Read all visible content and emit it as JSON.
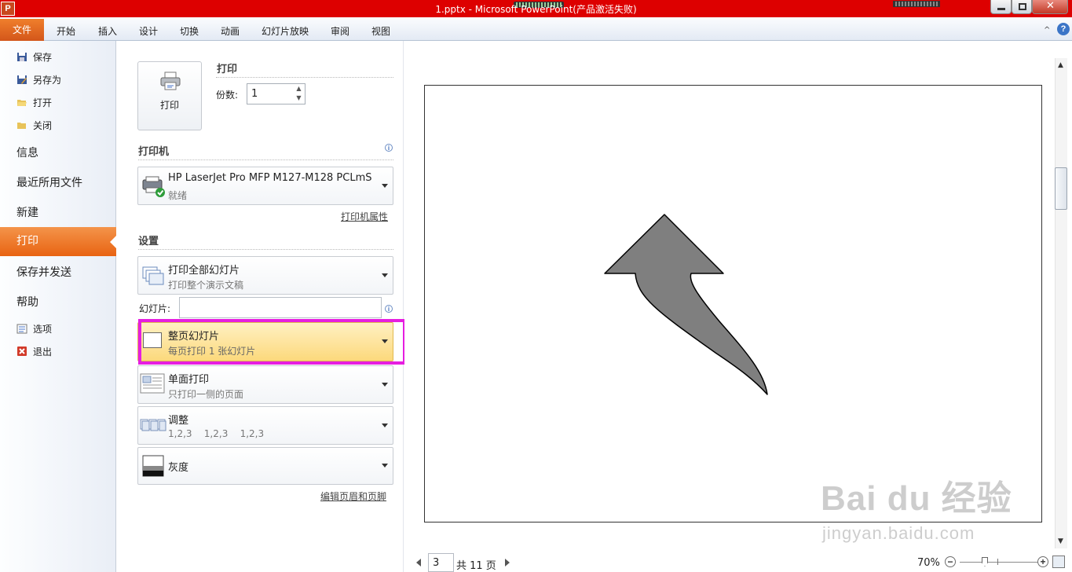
{
  "window": {
    "title": "1.pptx - Microsoft PowerPoint(产品激活失败)",
    "app_icon": "P"
  },
  "ribbon": {
    "file_tab": "文件",
    "tabs": [
      "开始",
      "插入",
      "设计",
      "切换",
      "动画",
      "幻灯片放映",
      "审阅",
      "视图"
    ],
    "help_icon": "?"
  },
  "nav": {
    "save": "保存",
    "save_as": "另存为",
    "open": "打开",
    "close": "关闭",
    "info": "信息",
    "recent": "最近所用文件",
    "new": "新建",
    "print": "打印",
    "save_send": "保存并发送",
    "help": "帮助",
    "options": "选项",
    "exit": "退出"
  },
  "print": {
    "button_label": "打印",
    "section_title": "打印",
    "copies_label": "份数:",
    "copies_value": "1"
  },
  "printer": {
    "section_title": "打印机",
    "name": "HP LaserJet Pro MFP M127-M128 PCLmS",
    "status": "就绪",
    "properties_link": "打印机属性"
  },
  "settings": {
    "section_title": "设置",
    "range": {
      "title": "打印全部幻灯片",
      "subtitle": "打印整个演示文稿"
    },
    "slides_label": "幻灯片:",
    "slides_value": "",
    "layout": {
      "title": "整页幻灯片",
      "subtitle": "每页打印 1 张幻灯片"
    },
    "sides": {
      "title": "单面打印",
      "subtitle": "只打印一侧的页面"
    },
    "collate": {
      "title": "调整",
      "subtitle": "1,2,3    1,2,3    1,2,3"
    },
    "color": {
      "title": "灰度"
    },
    "header_footer_link": "编辑页眉和页脚"
  },
  "preview": {
    "current_page": "3",
    "total_pages": "共 11 页",
    "zoom": "70%",
    "zoom_level_percent": 70,
    "shape": "curved-arrow"
  },
  "watermark": {
    "logo": "Bai du 经验",
    "url": "jingyan.baidu.com"
  },
  "colors": {
    "title_bar": "#dd0000",
    "file_tab": "#e2661e",
    "nav_active": "#ee741f",
    "highlight_box": "#e61ee0",
    "layout_selected": "#fde08a"
  }
}
